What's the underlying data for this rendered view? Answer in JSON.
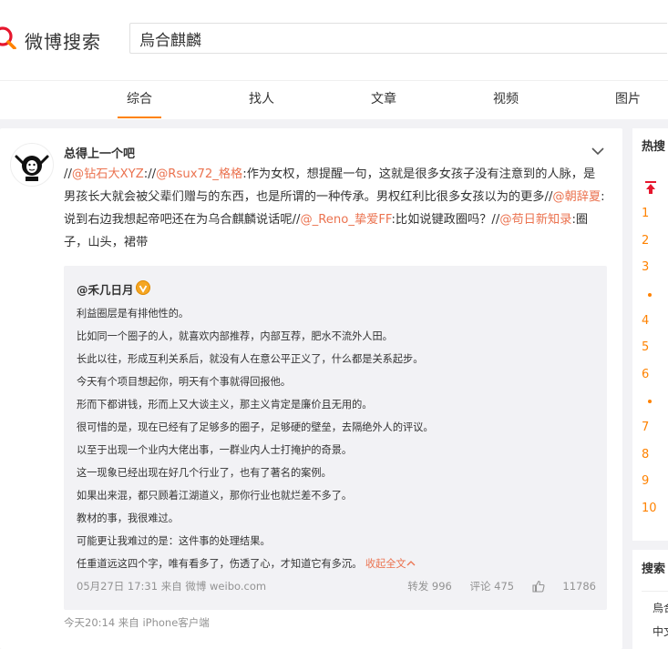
{
  "header": {
    "logo_text": "微博搜索",
    "search_value": "烏合麒麟"
  },
  "tabs": [
    {
      "label": "综合",
      "active": true
    },
    {
      "label": "找人",
      "active": false
    },
    {
      "label": "文章",
      "active": false
    },
    {
      "label": "视频",
      "active": false
    },
    {
      "label": "图片",
      "active": false
    }
  ],
  "post": {
    "author": "总得上一个吧",
    "body": [
      {
        "t": "text",
        "v": "//"
      },
      {
        "t": "mention",
        "v": "@钻石大XYZ"
      },
      {
        "t": "text",
        "v": ":"
      },
      {
        "t": "text",
        "v": "//"
      },
      {
        "t": "mention",
        "v": "@Rsux72_格格"
      },
      {
        "t": "text",
        "v": ":作为女权，想提醒一句，这就是很多女孩子没有注意到的人脉，是男孩长大就会被父辈们赠与的东西，也是所谓的一种传承。男权红利比很多女孩以为的更多"
      },
      {
        "t": "text",
        "v": "//"
      },
      {
        "t": "mention",
        "v": "@朝辞夏"
      },
      {
        "t": "text",
        "v": ":说到右边我想起帝吧还在为乌合麒麟说话呢"
      },
      {
        "t": "text",
        "v": "//"
      },
      {
        "t": "mention",
        "v": "@_Reno_挚爱FF"
      },
      {
        "t": "text",
        "v": ":比如说键政圈吗？"
      },
      {
        "t": "text",
        "v": "//"
      },
      {
        "t": "mention",
        "v": "@苟日新知录"
      },
      {
        "t": "text",
        "v": ":圈子，山头，裙带"
      }
    ],
    "meta": "今天20:14  来自 iPhone客户端"
  },
  "quote": {
    "author": "@禾几日月",
    "lines": [
      "利益圈层是有排他性的。",
      "比如同一个圈子的人，就喜欢内部推荐，内部互荐，肥水不流外人田。",
      "长此以往，形成互利关系后，就没有人在意公平正义了，什么都是关系起步。",
      "今天有个项目想起你，明天有个事就得回报他。",
      "形而下都讲钱，形而上又大谈主义，那主义肯定是廉价且无用的。",
      "很可惜的是，现在已经有了足够多的圈子，足够硬的壁垒，去隔绝外人的评议。",
      "以至于出现一个业内大佬出事，一群业内人士打掩护的奇景。",
      "这一现象已经出现在好几个行业了，也有了著名的案例。",
      "如果出来混，都只顾着江湖道义，那你行业也就烂差不多了。",
      "教材的事，我很难过。",
      "可能更让我难过的是：这件事的处理结果。",
      "任重道远这四个字，唯有看多了，伤透了心，才知道它有多沉。"
    ],
    "collapse_label": "收起全文",
    "time": "05月27日 17:31 来自 微博 weibo.com",
    "repost": "转发 996",
    "comment": "评论 475",
    "like": "11786"
  },
  "sidebar": {
    "hot_title": "热搜",
    "ranks": [
      "1",
      "2",
      "3",
      "4",
      "5",
      "6",
      "7",
      "8",
      "9",
      "10"
    ],
    "search_title": "搜索",
    "search_items": [
      "烏合",
      "中文"
    ]
  },
  "colors": {
    "accent": "#ff8200",
    "link": "#eb7350",
    "bg": "#f2f2f5"
  }
}
